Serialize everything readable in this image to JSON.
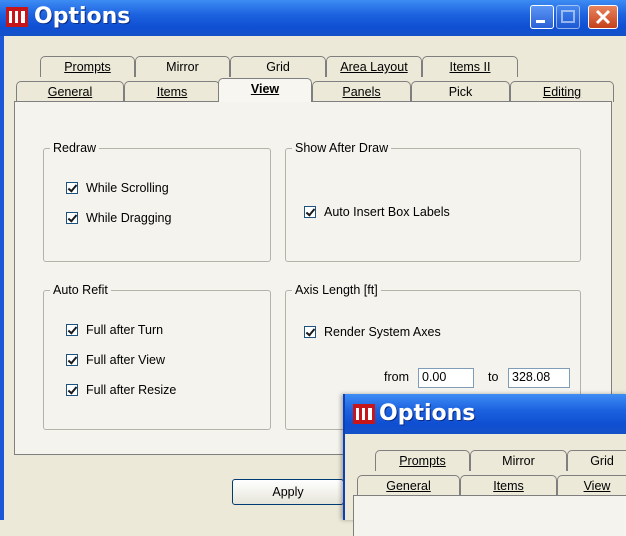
{
  "main_window": {
    "title": "Options",
    "tabs_back": [
      {
        "label": "Prompts"
      },
      {
        "label": "Mirror"
      },
      {
        "label": "Grid"
      },
      {
        "label": "Area Layout"
      },
      {
        "label": "Items II"
      }
    ],
    "tabs_front": [
      {
        "label": "General"
      },
      {
        "label": "Items"
      },
      {
        "label": "View"
      },
      {
        "label": "Panels"
      },
      {
        "label": "Pick"
      },
      {
        "label": "Editing"
      }
    ],
    "active_tab": "View",
    "groups": {
      "redraw": {
        "title": "Redraw",
        "options": [
          {
            "label": "While Scrolling",
            "checked": true
          },
          {
            "label": "While Dragging",
            "checked": true
          }
        ]
      },
      "show_after_draw": {
        "title": "Show After Draw",
        "options": [
          {
            "label": "Auto Insert Box Labels",
            "checked": true
          }
        ]
      },
      "auto_refit": {
        "title": "Auto Refit",
        "options": [
          {
            "label": "Full after Turn",
            "checked": true
          },
          {
            "label": "Full after View",
            "checked": true
          },
          {
            "label": "Full after Resize",
            "checked": true
          }
        ]
      },
      "axis_length": {
        "title": "Axis Length [ft]",
        "options": [
          {
            "label": "Render System Axes",
            "checked": true
          }
        ],
        "from_label": "from",
        "from_value": "0.00",
        "to_label": "to",
        "to_value": "328.08"
      }
    },
    "apply_label": "Apply"
  },
  "overlay_window": {
    "title": "Options",
    "tabs_back": [
      {
        "label": "Prompts"
      },
      {
        "label": "Mirror"
      },
      {
        "label": "Grid"
      }
    ],
    "tabs_front": [
      {
        "label": "General"
      },
      {
        "label": "Items"
      },
      {
        "label": "View"
      }
    ]
  },
  "colors": {
    "titlebar": "#1d63e0",
    "dialog": "#ece9d8",
    "close": "#c5401c"
  }
}
